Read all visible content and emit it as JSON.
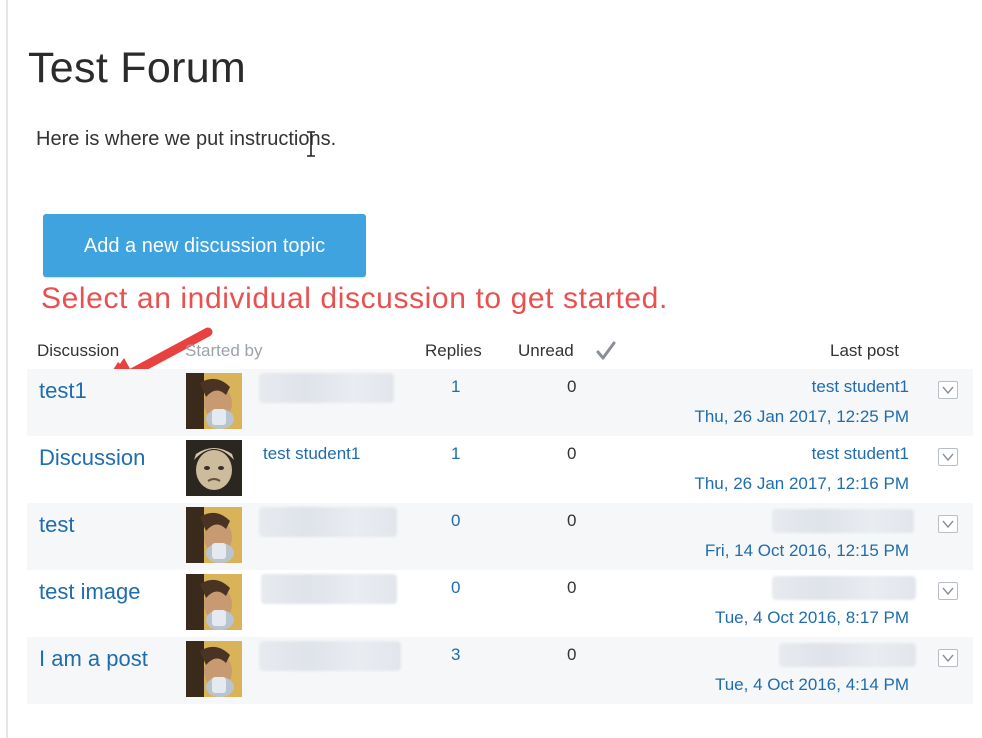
{
  "page": {
    "title": "Test Forum",
    "intro": "Here is where we put instructions.",
    "add_button": "Add a new discussion topic",
    "annotation": "Select an individual discussion to get started."
  },
  "colors": {
    "button": "#3ea3de",
    "link": "#1f6cae",
    "annotation": "#e95050",
    "row_shade": "#f6f7f8"
  },
  "table": {
    "headers": {
      "discussion": "Discussion",
      "started_by": "Started by",
      "replies": "Replies",
      "unread": "Unread",
      "last_post": "Last post"
    },
    "rows": [
      {
        "discussion": "test1",
        "started_by": "",
        "replies": "1",
        "unread": "0",
        "last_post_author": "test student1",
        "last_post_date": "Thu, 26 Jan 2017, 12:25 PM"
      },
      {
        "discussion": "Discussion",
        "started_by": "test student1",
        "replies": "1",
        "unread": "0",
        "last_post_author": "test student1",
        "last_post_date": "Thu, 26 Jan 2017, 12:16 PM"
      },
      {
        "discussion": "test",
        "started_by": "",
        "replies": "0",
        "unread": "0",
        "last_post_author": "",
        "last_post_date": "Fri, 14 Oct 2016, 12:15 PM"
      },
      {
        "discussion": "test image",
        "started_by": "",
        "replies": "0",
        "unread": "0",
        "last_post_author": "",
        "last_post_date": "Tue, 4 Oct 2016, 8:17 PM"
      },
      {
        "discussion": "I am a post",
        "started_by": "",
        "replies": "3",
        "unread": "0",
        "last_post_author": "",
        "last_post_date": "Tue, 4 Oct 2016, 4:14 PM"
      }
    ]
  }
}
